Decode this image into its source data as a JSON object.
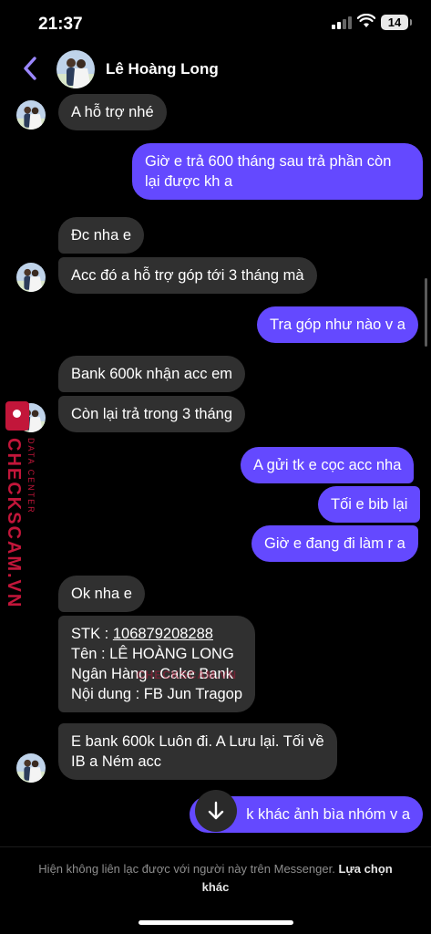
{
  "status_bar": {
    "time": "21:37",
    "battery": "14"
  },
  "header": {
    "contact_name": "Lê Hoàng Long"
  },
  "messages": [
    {
      "text": "A hỗ trợ nhé"
    },
    {
      "lines": [
        "Giờ e trả 600 tháng sau trả phần còn",
        "lại được kh a"
      ]
    },
    {
      "text": "Đc nha e"
    },
    {
      "text": "Acc đó a hỗ trợ góp tới 3 tháng mà"
    },
    {
      "text": "Tra góp như nào v a"
    },
    {
      "text": "Bank 600k nhận acc em"
    },
    {
      "text": "Còn lại trả trong 3 tháng"
    },
    {
      "text": "A gửi tk e cọc acc nha"
    },
    {
      "text": "Tối e bib lại"
    },
    {
      "text": "Giờ e đang đi làm r a"
    },
    {
      "text": "Ok nha e"
    },
    {
      "stk_label": "STK : ",
      "stk_number": "106879208288",
      "lines": [
        "Tên : LÊ HOÀNG LONG",
        "Ngân Hàng : Cake Bank",
        "Nội dung : FB Jun Tragop"
      ]
    },
    {
      "lines": [
        "E bank 600k Luôn đi. A Lưu lại. Tối về",
        "IB a Ném acc"
      ]
    },
    {
      "text": "k khác ảnh bìa nhóm v a"
    }
  ],
  "watermark": {
    "brand": "CHECKSCAM.VN",
    "sub": "DATA CENTER",
    "center": "CHECKSCAM.VN"
  },
  "footer": {
    "notice": "Hiện không liên lạc được với người này trên Messenger.",
    "link": "Lựa chọn khác"
  },
  "colors": {
    "outgoing": "#6449ff",
    "incoming": "#303030",
    "accent": "#9b87ff",
    "watermark": "#c2163a"
  }
}
